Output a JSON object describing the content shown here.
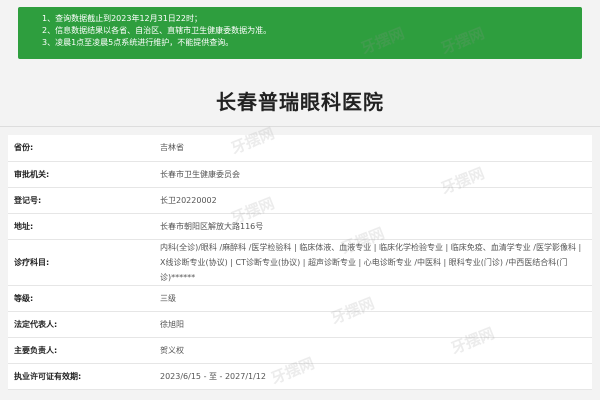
{
  "notice": {
    "lines": [
      "1、查询数据截止到2023年12月31日22时；",
      "2、信息数据结果以各省、自治区、直辖市卫生健康委数据为准。",
      "3、凌晨1点至凌晨5点系统进行维护，不能提供查询。"
    ]
  },
  "page_title": "长春普瑞眼科医院",
  "rows": [
    {
      "label": "省份:",
      "value": "吉林省"
    },
    {
      "label": "审批机关:",
      "value": "长春市卫生健康委员会"
    },
    {
      "label": "登记号:",
      "value": "长卫20220002"
    },
    {
      "label": "地址:",
      "value": "长春市朝阳区解放大路116号"
    },
    {
      "label": "诊疗科目:",
      "value": "内科(全诊)/眼科 /麻醉科 /医学检验科 | 临床体液、血液专业 | 临床化学检验专业 | 临床免疫、血清学专业 /医学影像科 | X线诊断专业(协议) | CT诊断专业(协议) | 超声诊断专业 | 心电诊断专业 /中医科 | 眼科专业(门诊) /中西医结合科(门诊)******"
    },
    {
      "label": "等级:",
      "value": "三级"
    },
    {
      "label": "法定代表人:",
      "value": "徐旭阳"
    },
    {
      "label": "主要负责人:",
      "value": "贺义权"
    },
    {
      "label": "执业许可证有效期:",
      "value": "2023/6/15 - 至 - 2027/1/12"
    }
  ],
  "watermark": "牙摆网"
}
